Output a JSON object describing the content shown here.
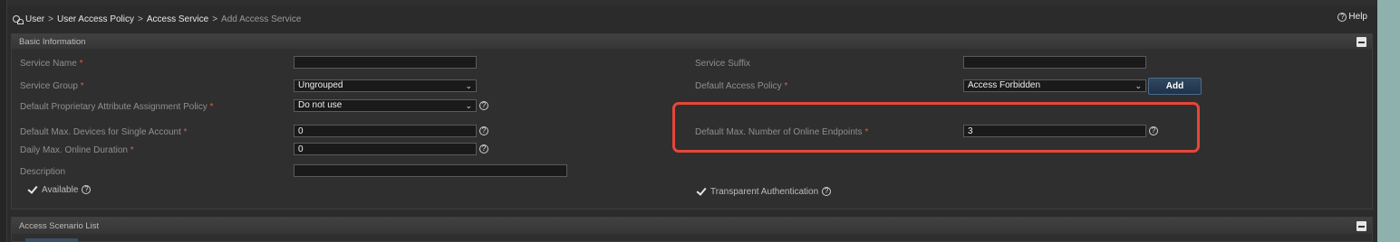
{
  "breadcrumb": {
    "items": [
      "User",
      "User Access Policy",
      "Access Service"
    ],
    "current": "Add Access Service",
    "separator": ">"
  },
  "help": {
    "label": "Help"
  },
  "basic_info": {
    "title": "Basic Information",
    "service_name": {
      "label": "Service Name",
      "required": "*",
      "value": ""
    },
    "service_suffix": {
      "label": "Service Suffix",
      "value": ""
    },
    "service_group": {
      "label": "Service Group",
      "required": "*",
      "value": "Ungrouped"
    },
    "default_access_policy": {
      "label": "Default Access Policy",
      "required": "*",
      "value": "Access Forbidden"
    },
    "add_button": "Add",
    "proprietary_policy": {
      "label": "Default Proprietary Attribute Assignment Policy",
      "required": "*",
      "value": "Do not use"
    },
    "max_devices": {
      "label": "Default Max. Devices for Single Account",
      "required": "*",
      "value": "0"
    },
    "max_online_endpoints": {
      "label": "Default Max. Number of Online Endpoints",
      "required": "*",
      "value": "3"
    },
    "daily_max_duration": {
      "label": "Daily Max. Online Duration",
      "required": "*",
      "value": "0"
    },
    "description": {
      "label": "Description",
      "value": ""
    },
    "available": {
      "label": "Available",
      "checked": true
    },
    "transparent_auth": {
      "label": "Transparent Authentication",
      "checked": true
    }
  },
  "access_scenario": {
    "title": "Access Scenario List"
  },
  "icons": {
    "help": "?",
    "caret": "⌄"
  },
  "colors": {
    "highlight": "#e8463a",
    "required": "#e15c4a",
    "add_button": "#2a4058"
  }
}
